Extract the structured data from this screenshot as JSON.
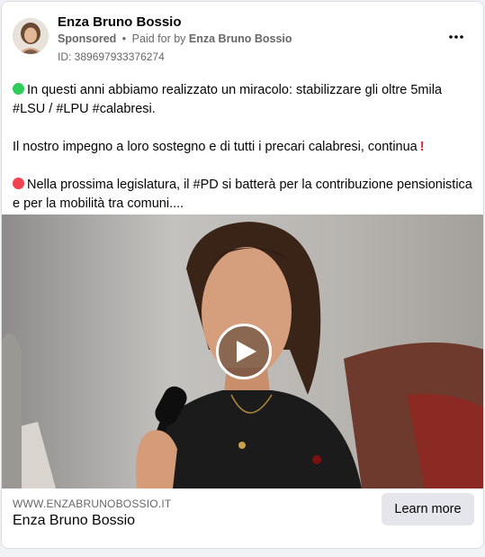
{
  "ad": {
    "page_name": "Enza Bruno Bossio",
    "sponsored_label": "Sponsored",
    "separator": "•",
    "paid_for_prefix": "Paid for by",
    "paid_for_by": "Enza Bruno Bossio",
    "id_text": "ID: 389697933376274",
    "more_icon": "more-horizontal-icon"
  },
  "body": {
    "para1": "In questi anni abbiamo realizzato un miracolo: stabilizzare gli oltre 5mila #LSU / #LPU #calabresi.",
    "para2": "Il nostro impegno a loro sostegno e di tutti i precari calabresi, continua",
    "para3": "Nella prossima legislatura, il #PD si batterà per la contribuzione pensionistica e per la mobilità tra comuni...."
  },
  "media": {
    "type": "video",
    "play_icon": "play-icon"
  },
  "footer": {
    "domain": "WWW.ENZABRUNOBOSSIO.IT",
    "title": "Enza Bruno Bossio",
    "cta_label": "Learn more"
  },
  "colors": {
    "green_dot": "#2ecc59",
    "red_dot": "#f0434f",
    "exclamation": "#e0202f",
    "cta_bg": "#e4e6eb",
    "secondary_text": "#65676b"
  }
}
